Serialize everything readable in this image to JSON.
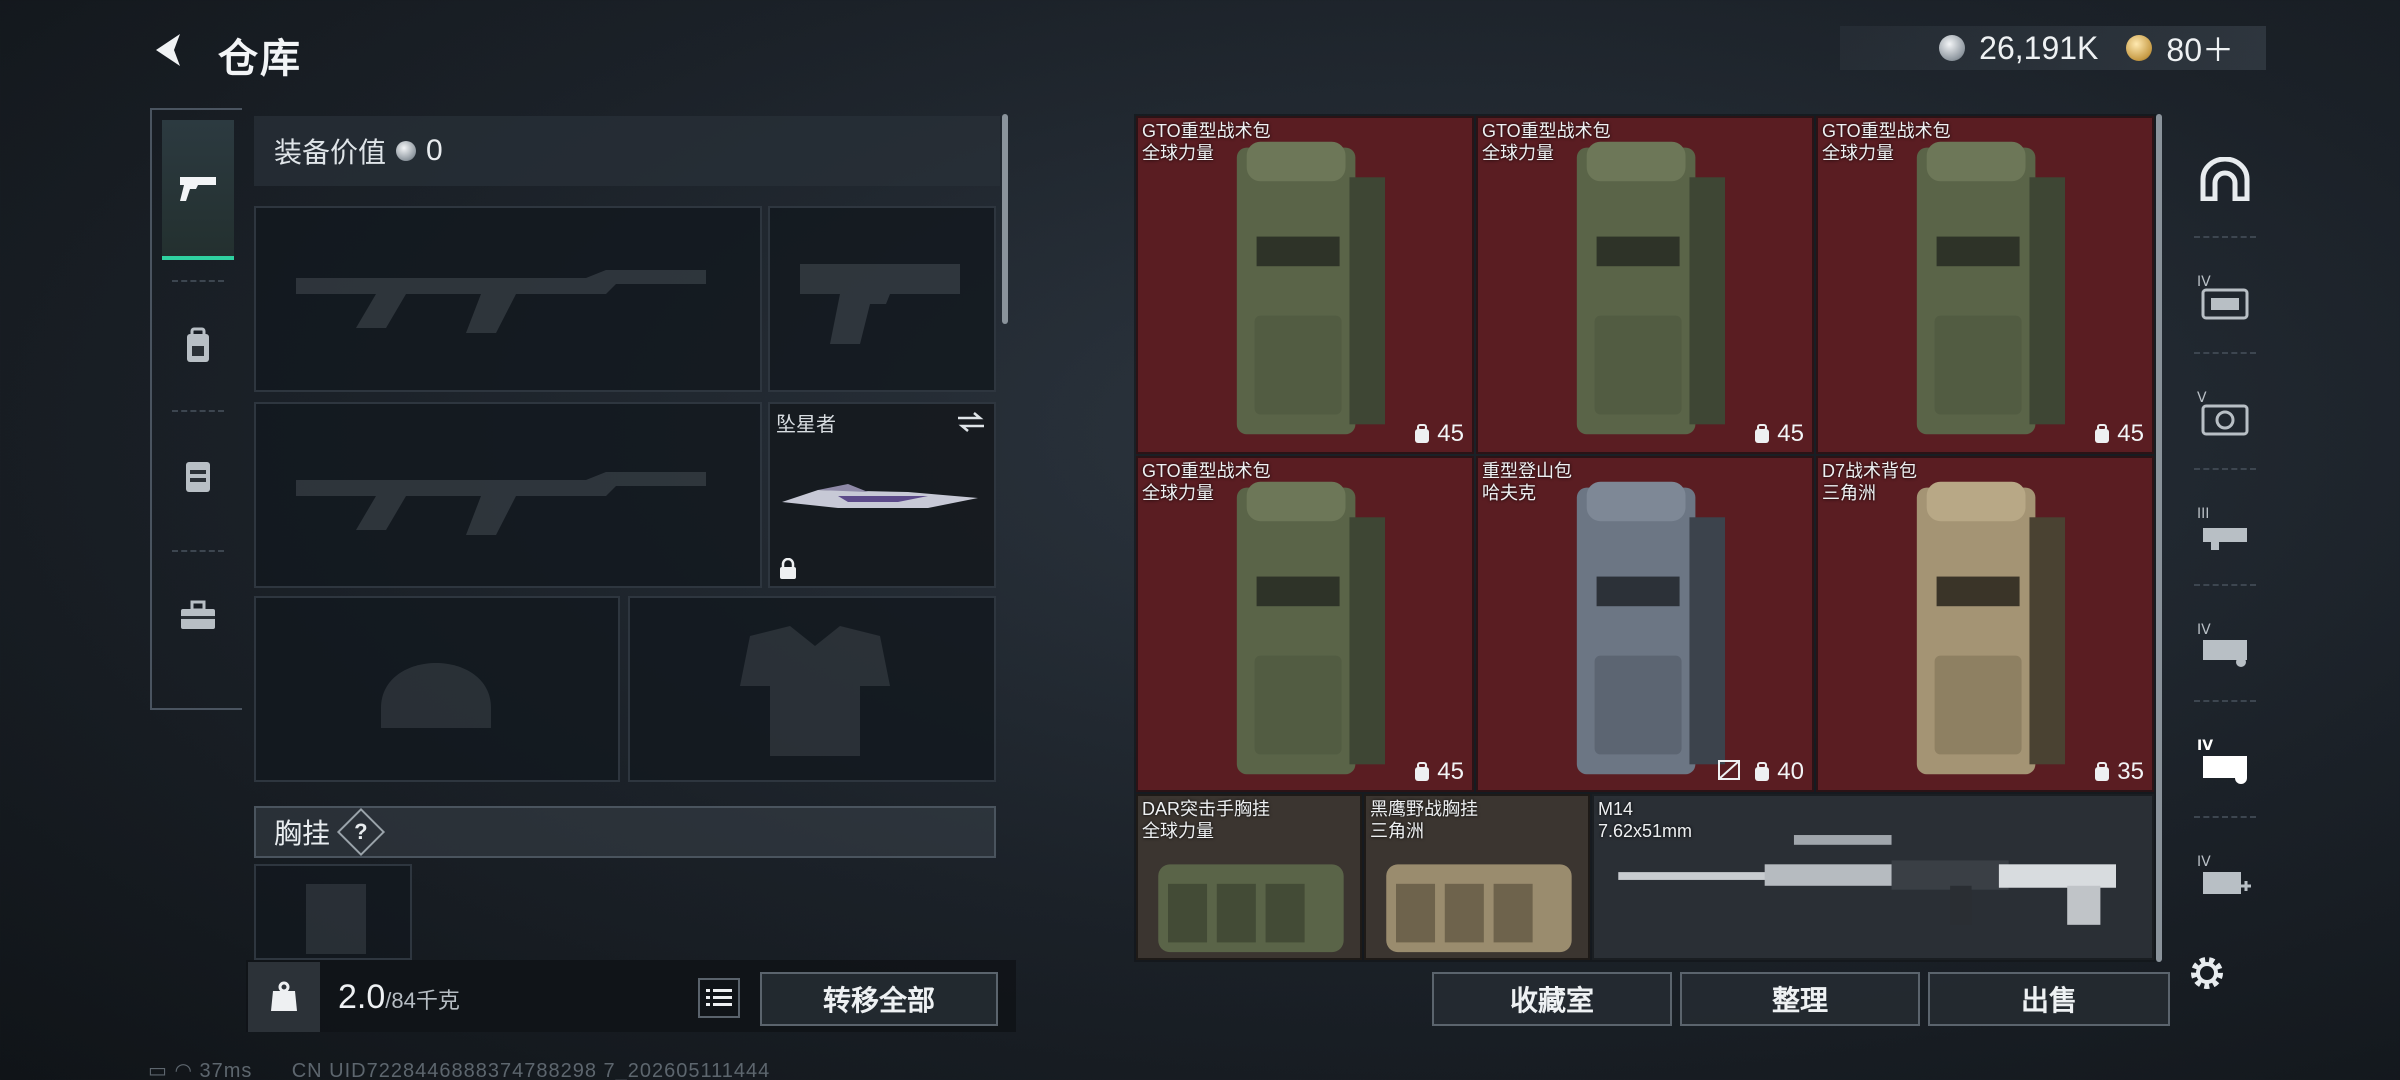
{
  "header": {
    "title": "仓库",
    "currency": [
      {
        "icon": "silver-coin-icon",
        "value": "26,191K"
      },
      {
        "icon": "gold-coin-icon",
        "value": "80＋"
      }
    ]
  },
  "categories": [
    {
      "icon": "pistol-icon",
      "active": true
    },
    {
      "icon": "backpack-icon",
      "active": false
    },
    {
      "icon": "vest-icon",
      "active": false
    },
    {
      "icon": "toolbox-icon",
      "active": false
    }
  ],
  "equipment": {
    "value_label": "装备价值",
    "value": "0",
    "melee_name": "坠星者",
    "chest_label": "胸挂",
    "chest_help": "?"
  },
  "weight": {
    "current": "2.0",
    "max": "/84千克"
  },
  "left_buttons": {
    "transfer_all": "转移全部"
  },
  "storage_items": [
    {
      "name1": "GTO重型战术包",
      "name2": "全球力量",
      "count": "45",
      "color": "olive"
    },
    {
      "name1": "GTO重型战术包",
      "name2": "全球力量",
      "count": "45",
      "color": "olive"
    },
    {
      "name1": "GTO重型战术包",
      "name2": "全球力量",
      "count": "45",
      "color": "olive"
    },
    {
      "name1": "GTO重型战术包",
      "name2": "全球力量",
      "count": "45",
      "color": "olive"
    },
    {
      "name1": "重型登山包",
      "name2": "哈夫克",
      "count": "40",
      "color": "grey"
    },
    {
      "name1": "D7战术背包",
      "name2": "三角洲",
      "count": "35",
      "color": "tan"
    },
    {
      "name1": "DAR突击手胸挂",
      "name2": "全球力量",
      "color": "olive"
    },
    {
      "name1": "黑鹰野战胸挂",
      "name2": "三角洲",
      "color": "tan"
    },
    {
      "name1": "M14",
      "name2": "7.62x51mm"
    }
  ],
  "storage_buttons": {
    "collection": "收藏室",
    "organize": "整理",
    "sell": "出售"
  },
  "right_tabs": [
    {
      "icon": "arch-icon"
    },
    {
      "icon": "storage-tier4-a-icon",
      "label": "IV"
    },
    {
      "icon": "storage-tier5-icon",
      "label": "V"
    },
    {
      "icon": "storage-tier3-icon",
      "label": "III"
    },
    {
      "icon": "storage-tier4-b-icon",
      "label": "IV"
    },
    {
      "icon": "storage-tier4-active-icon",
      "label": "IV"
    },
    {
      "icon": "storage-add-icon",
      "label": "IV"
    },
    {
      "icon": "settings-gear-icon"
    }
  ],
  "status": {
    "ping": "37ms",
    "uid": "CN UID7228446888374788298 7_202605111444"
  },
  "colors": {
    "accent": "#2fd1a0",
    "item_red": "#5a1d22"
  }
}
